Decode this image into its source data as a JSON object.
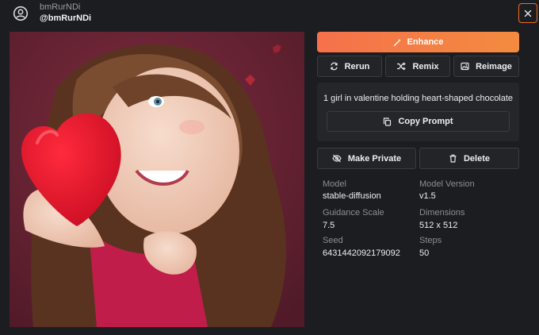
{
  "header": {
    "user_name": "bmRurNDi",
    "user_handle": "@bmRurNDi"
  },
  "actions": {
    "enhance_label": "Enhance",
    "rerun_label": "Rerun",
    "remix_label": "Remix",
    "reimage_label": "Reimage",
    "make_private_label": "Make Private",
    "delete_label": "Delete"
  },
  "prompt": {
    "text": "1 girl in valentine holding heart-shaped chocolate",
    "copy_label": "Copy Prompt"
  },
  "details": {
    "model_label": "Model",
    "model_value": "stable-diffusion",
    "version_label": "Model Version",
    "version_value": "v1.5",
    "guidance_label": "Guidance Scale",
    "guidance_value": "7.5",
    "dimensions_label": "Dimensions",
    "dimensions_value": "512 x 512",
    "seed_label": "Seed",
    "seed_value": "6431442092179092",
    "steps_label": "Steps",
    "steps_value": "50"
  },
  "colors": {
    "accent": "#f26b2c",
    "enhance_start": "#f5714b",
    "enhance_end": "#f48b3f",
    "background": "#1c1d20",
    "panel": "#25262a"
  },
  "icons": {
    "avatar": "user-circle-icon",
    "close": "close-icon",
    "enhance": "magic-wand-icon",
    "rerun": "refresh-icon",
    "remix": "shuffle-icon",
    "reimage": "image-icon",
    "copy": "copy-icon",
    "private": "eye-off-icon",
    "delete": "trash-icon"
  }
}
